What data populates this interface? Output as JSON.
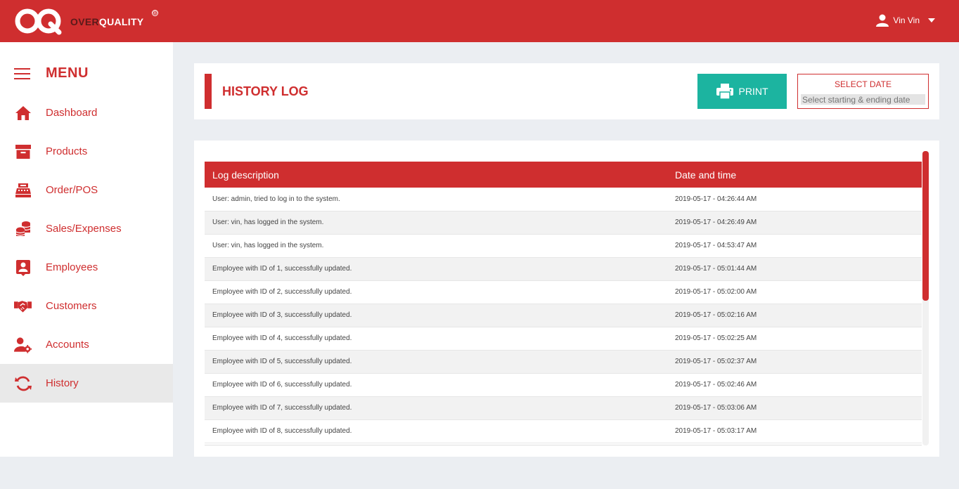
{
  "brand": {
    "name_part1": "OVER",
    "name_part2": "QUALITY",
    "reg": "®"
  },
  "user": {
    "name": "Vin Vin"
  },
  "sidebar": {
    "title": "MENU",
    "items": [
      {
        "label": "Dashboard",
        "icon": "home-icon"
      },
      {
        "label": "Products",
        "icon": "archive-box-icon"
      },
      {
        "label": "Order/POS",
        "icon": "cash-register-icon"
      },
      {
        "label": "Sales/Expenses",
        "icon": "coins-icon"
      },
      {
        "label": "Employees",
        "icon": "id-badge-icon"
      },
      {
        "label": "Customers",
        "icon": "handshake-icon"
      },
      {
        "label": "Accounts",
        "icon": "user-gear-icon"
      },
      {
        "label": "History",
        "icon": "refresh-icon",
        "active": true
      }
    ]
  },
  "header": {
    "title": "HISTORY LOG",
    "print_label": "PRINT",
    "date_title": "SELECT DATE",
    "date_placeholder": "Select starting & ending date"
  },
  "table": {
    "columns": [
      "Log description",
      "Date and time"
    ],
    "rows": [
      [
        "User: admin, tried to log in to the system.",
        "2019-05-17 - 04:26:44 AM"
      ],
      [
        "User: vin, has logged in the system.",
        "2019-05-17 - 04:26:49 AM"
      ],
      [
        "User: vin, has logged in the system.",
        "2019-05-17 - 04:53:47 AM"
      ],
      [
        "Employee with ID of 1, successfully updated.",
        "2019-05-17 - 05:01:44 AM"
      ],
      [
        "Employee with ID of 2, successfully updated.",
        "2019-05-17 - 05:02:00 AM"
      ],
      [
        "Employee with ID of 3, successfully updated.",
        "2019-05-17 - 05:02:16 AM"
      ],
      [
        "Employee with ID of 4, successfully updated.",
        "2019-05-17 - 05:02:25 AM"
      ],
      [
        "Employee with ID of 5, successfully updated.",
        "2019-05-17 - 05:02:37 AM"
      ],
      [
        "Employee with ID of 6, successfully updated.",
        "2019-05-17 - 05:02:46 AM"
      ],
      [
        "Employee with ID of 7, successfully updated.",
        "2019-05-17 - 05:03:06 AM"
      ],
      [
        "Employee with ID of 8, successfully updated.",
        "2019-05-17 - 05:03:17 AM"
      ]
    ]
  },
  "colors": {
    "accent": "#cf2e2f",
    "print_button": "#1cb4a0",
    "page_bg": "#ebeef2"
  }
}
